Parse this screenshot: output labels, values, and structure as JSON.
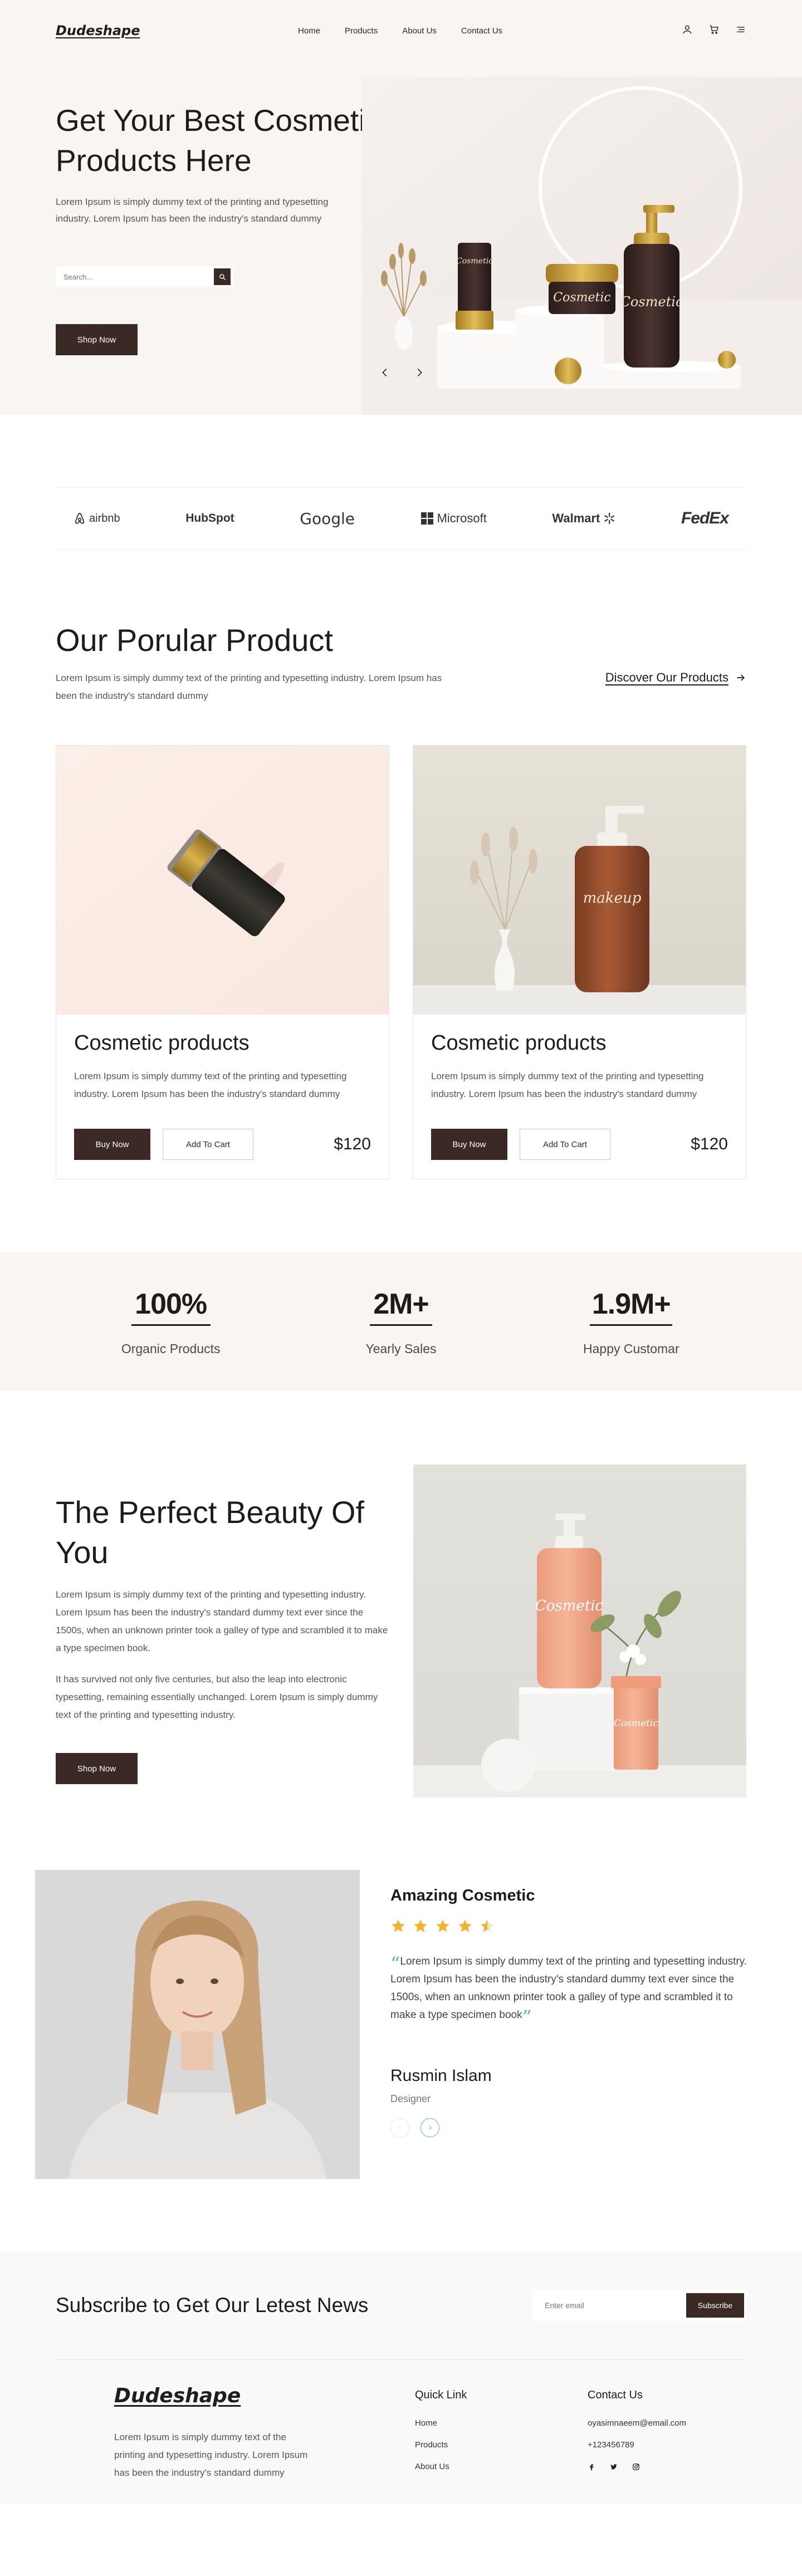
{
  "header": {
    "logo": "Dudeshape",
    "nav": [
      "Home",
      "Products",
      "About Us",
      "Contact Us"
    ],
    "icons": [
      "user-icon",
      "cart-icon",
      "menu-icon"
    ]
  },
  "hero": {
    "title": "Get Your Best Cosmetic Products Here",
    "description": "Lorem Ipsum is simply dummy text of the printing and typesetting industry. Lorem Ipsum has been the industry's standard dummy",
    "search_placeholder": "Search...",
    "cta": "Shop Now",
    "product_labels": [
      "Cosmetic",
      "Cosmetic",
      "Cosmetic"
    ]
  },
  "brands": [
    "airbnb",
    "HubSpot",
    "Google",
    "Microsoft",
    "Walmart",
    "FedEx"
  ],
  "products": {
    "title": "Our Porular Product",
    "description": "Lorem Ipsum is simply dummy text of the printing and typesetting industry. Lorem Ipsum has been the industry's standard dummy",
    "discover": "Discover Our Products",
    "cards": [
      {
        "title": "Cosmetic products",
        "description": "Lorem Ipsum is simply dummy text of the printing and typesetting industry. Lorem Ipsum has been the industry's standard dummy",
        "buy": "Buy Now",
        "cart": "Add To Cart",
        "price": "$120"
      },
      {
        "title": "Cosmetic products",
        "description": "Lorem Ipsum is simply dummy text of the printing and typesetting industry. Lorem Ipsum has been the industry's standard dummy",
        "buy": "Buy Now",
        "cart": "Add To Cart",
        "price": "$120",
        "bottle_label": "makeup"
      }
    ]
  },
  "stats": [
    {
      "value": "100%",
      "label": "Organic Products"
    },
    {
      "value": "2M+",
      "label": "Yearly Sales"
    },
    {
      "value": "1.9M+",
      "label": "Happy Customar"
    }
  ],
  "beauty": {
    "title": "The Perfect Beauty Of You",
    "p1": "Lorem Ipsum is simply dummy text of the printing and typesetting industry. Lorem Ipsum has been the industry's standard dummy text ever since the 1500s, when an unknown printer took a galley of type and scrambled it to make a type specimen book.",
    "p2": "It has survived not only five centuries, but also the leap into electronic typesetting, remaining essentially unchanged. Lorem Ipsum is simply dummy text of the printing and typesetting industry.",
    "cta": "Shop Now",
    "bottle_labels": [
      "Cosmetic",
      "Cosmetic"
    ]
  },
  "testimonial": {
    "heading": "Amazing Cosmetic",
    "rating": 4.5,
    "rating_max": 5,
    "quote": "Lorem Ipsum is simply dummy text of the printing and typesetting industry. Lorem Ipsum has been the industry's standard dummy text ever since the 1500s, when an unknown printer took a galley of type and scrambled it to make a type specimen book",
    "name": "Rusmin Islam",
    "role": "Designer",
    "star_color": "#f5b02e",
    "accent_color": "#5fb7a6"
  },
  "subscribe": {
    "title": "Subscribe to Get Our Letest News",
    "placeholder": "Enter email",
    "button": "Subscribe"
  },
  "footer": {
    "logo": "Dudeshape",
    "description": "Lorem Ipsum is simply dummy text of the printing and typesetting industry. Lorem Ipsum has been the industry's standard dummy",
    "quick_link_title": "Quick Link",
    "quick_links": [
      "Home",
      "Products",
      "About Us"
    ],
    "contact_title": "Contact Us",
    "email": "oyasimnaeem@email.com",
    "phone": "+123456789",
    "social_icons": [
      "facebook-icon",
      "twitter-icon",
      "instagram-icon"
    ]
  },
  "colors": {
    "primary": "#3b2926",
    "hero_bg": "#f8f5f3",
    "stats_bg": "#fbf5f1",
    "footer_bg": "#f9f9f9"
  }
}
